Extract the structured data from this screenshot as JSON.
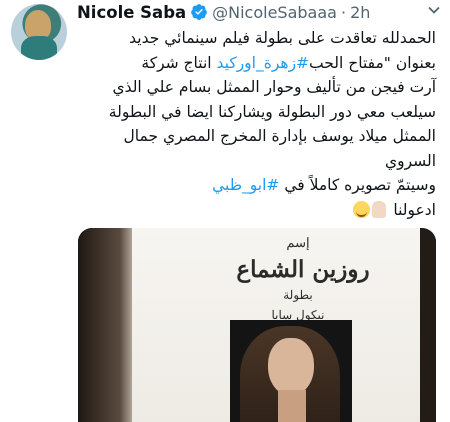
{
  "tweet": {
    "display_name": "Nicole Saba",
    "handle": "@NicoleSabaaa",
    "separator": "·",
    "time": "2h",
    "text_lines": {
      "l1": "الحمدلله تعاقدت على بطولة فيلم سينمائي جديد",
      "l2_pre": "بعنوان \"مفتاح الحب",
      "l2_hashtag": "#زهرة_اوركيد",
      "l2_post": " انتاج شركة",
      "l3": "آرت فيجن من تأليف وحوار الممثل بسام علي الذي",
      "l4": "سيلعب معي دور البطولة ويشاركنا ايضا في البطولة",
      "l5": "الممثل ميلاد يوسف بإدارة المخرج المصري جمال",
      "l6": "السروي",
      "l7_pre": "وسيتمّ تصويره كاملاً في ",
      "l7_hashtag": "#ابو_ظبي",
      "l8": "ادعولنا"
    },
    "emojis": [
      "folded-hands-emoji",
      "smiling-face-emoji"
    ]
  },
  "media": {
    "poster_text": {
      "t1": "إسم",
      "t2": "روزين الشماع",
      "t3": "بطولة",
      "t4": "نيكول سابا"
    }
  },
  "colors": {
    "accent": "#1d9bf0",
    "text": "#0f1419",
    "secondary": "#536471"
  }
}
